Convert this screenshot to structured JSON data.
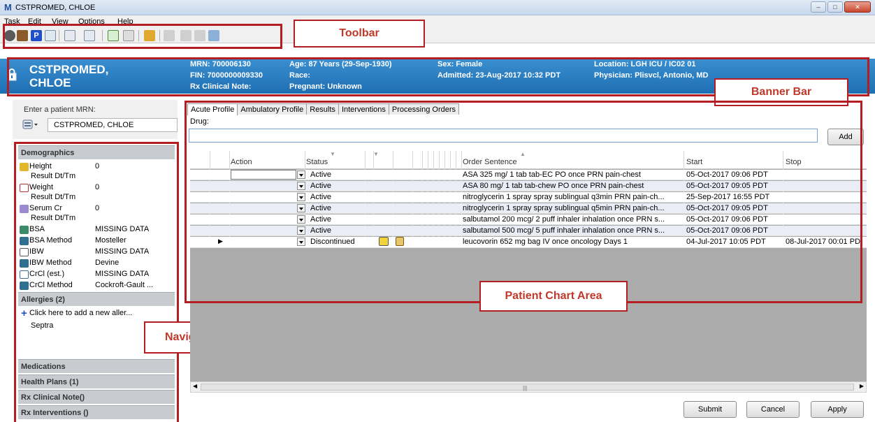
{
  "window": {
    "title": "CSTPROMED, CHLOE",
    "app_icon": "M"
  },
  "menu": [
    "Task",
    "Edit",
    "View",
    "Options",
    "Help"
  ],
  "banner": {
    "patient_name_line1": "CSTPROMED,",
    "patient_name_line2": "CHLOE",
    "mrn": "MRN: 700006130",
    "fin": "FIN: 7000000009330",
    "rx_note": "Rx Clinical Note:",
    "age": "Age: 87 Years (29-Sep-1930)",
    "race": "Race:",
    "pregnant": "Pregnant: Unknown",
    "sex": "Sex: Female",
    "admitted": "Admitted: 23-Aug-2017 10:32 PDT",
    "location": "Location: LGH ICU / IC02 01",
    "physician": "Physician: Plisvcl, Antonio, MD"
  },
  "annotations": {
    "toolbar": "Toolbar",
    "banner_bar": "Banner Bar",
    "patient_chart_area": "Patient Chart Area",
    "navigator_section": "Navigator Section"
  },
  "search": {
    "label": "Enter a patient MRN:",
    "value": "CSTPROMED, CHLOE"
  },
  "navigator": {
    "demographics_header": "Demographics",
    "demographics": [
      {
        "label": "Height",
        "value": "0",
        "icon": "ruler-icon"
      },
      {
        "sub": "Result Dt/Tm"
      },
      {
        "label": "Weight",
        "value": "0",
        "icon": "scale-icon"
      },
      {
        "sub": "Result Dt/Tm"
      },
      {
        "label": "Serum Cr",
        "value": "0",
        "icon": "lab-icon"
      },
      {
        "sub": "Result Dt/Tm"
      },
      {
        "label": "BSA",
        "value": "MISSING DATA",
        "icon": "calculator-icon"
      },
      {
        "label": "BSA Method",
        "value": "Mosteller",
        "icon": "calculator-icon"
      },
      {
        "label": "IBW",
        "value": "MISSING DATA",
        "icon": "scale-icon"
      },
      {
        "label": "IBW Method",
        "value": "Devine",
        "icon": "calculator-icon"
      },
      {
        "label": "CrCl (est.)",
        "value": "MISSING DATA",
        "icon": "calculator-icon"
      },
      {
        "label": "CrCl Method",
        "value": "Cockroft-Gault ...",
        "icon": "calculator-icon"
      }
    ],
    "allergies_header": "Allergies (2)",
    "add_allergy": "Click here to add a new aller...",
    "allergy_item": "Septra",
    "medications_header": "Medications",
    "health_plans_header": "Health Plans (1)",
    "rx_clinical_note_header": "Rx Clinical Note()",
    "rx_interventions_header": "Rx Interventions ()"
  },
  "tabs": [
    "Acute Profile",
    "Ambulatory Profile",
    "Results",
    "Interventions",
    "Processing Orders"
  ],
  "drug": {
    "label": "Drug:",
    "value": "",
    "add_button": "Add"
  },
  "grid": {
    "columns": {
      "action": "Action",
      "status": "Status",
      "order_sentence": "Order Sentence",
      "start": "Start",
      "stop": "Stop"
    },
    "rows": [
      {
        "status": "Active",
        "order": "ASA 325 mg/ 1 tab tab-EC PO once  PRN pain-chest",
        "start": "05-Oct-2017 09:06 PDT",
        "stop": ""
      },
      {
        "status": "Active",
        "order": "ASA 80 mg/ 1 tab tab-chew PO once  PRN pain-chest",
        "start": "05-Oct-2017 09:05 PDT",
        "stop": ""
      },
      {
        "status": "Active",
        "order": "nitroglycerin  1 spray spray sublingual q3min  PRN pain-ch...",
        "start": "25-Sep-2017 16:55 PDT",
        "stop": ""
      },
      {
        "status": "Active",
        "order": "nitroglycerin  1 spray spray sublingual q5min  PRN pain-ch...",
        "start": "05-Oct-2017 09:05 PDT",
        "stop": ""
      },
      {
        "status": "Active",
        "order": "salbutamol 200 mcg/ 2 puff inhaler inhalation once  PRN s...",
        "start": "05-Oct-2017 09:06 PDT",
        "stop": ""
      },
      {
        "status": "Active",
        "order": "salbutamol 500 mcg/ 5 puff inhaler inhalation once  PRN s...",
        "start": "05-Oct-2017 09:06 PDT",
        "stop": ""
      },
      {
        "status": "Discontinued",
        "order": "leucovorin 652 mg bag IV once oncology Days 1",
        "start": "04-Jul-2017 10:05 PDT",
        "stop": "08-Jul-2017 00:01 PD"
      }
    ]
  },
  "footer": {
    "submit": "Submit",
    "cancel": "Cancel",
    "apply": "Apply"
  },
  "colors": {
    "banner": "#1e6fb3",
    "annotation": "#b21e22",
    "nav_header": "#c8ccd1"
  }
}
